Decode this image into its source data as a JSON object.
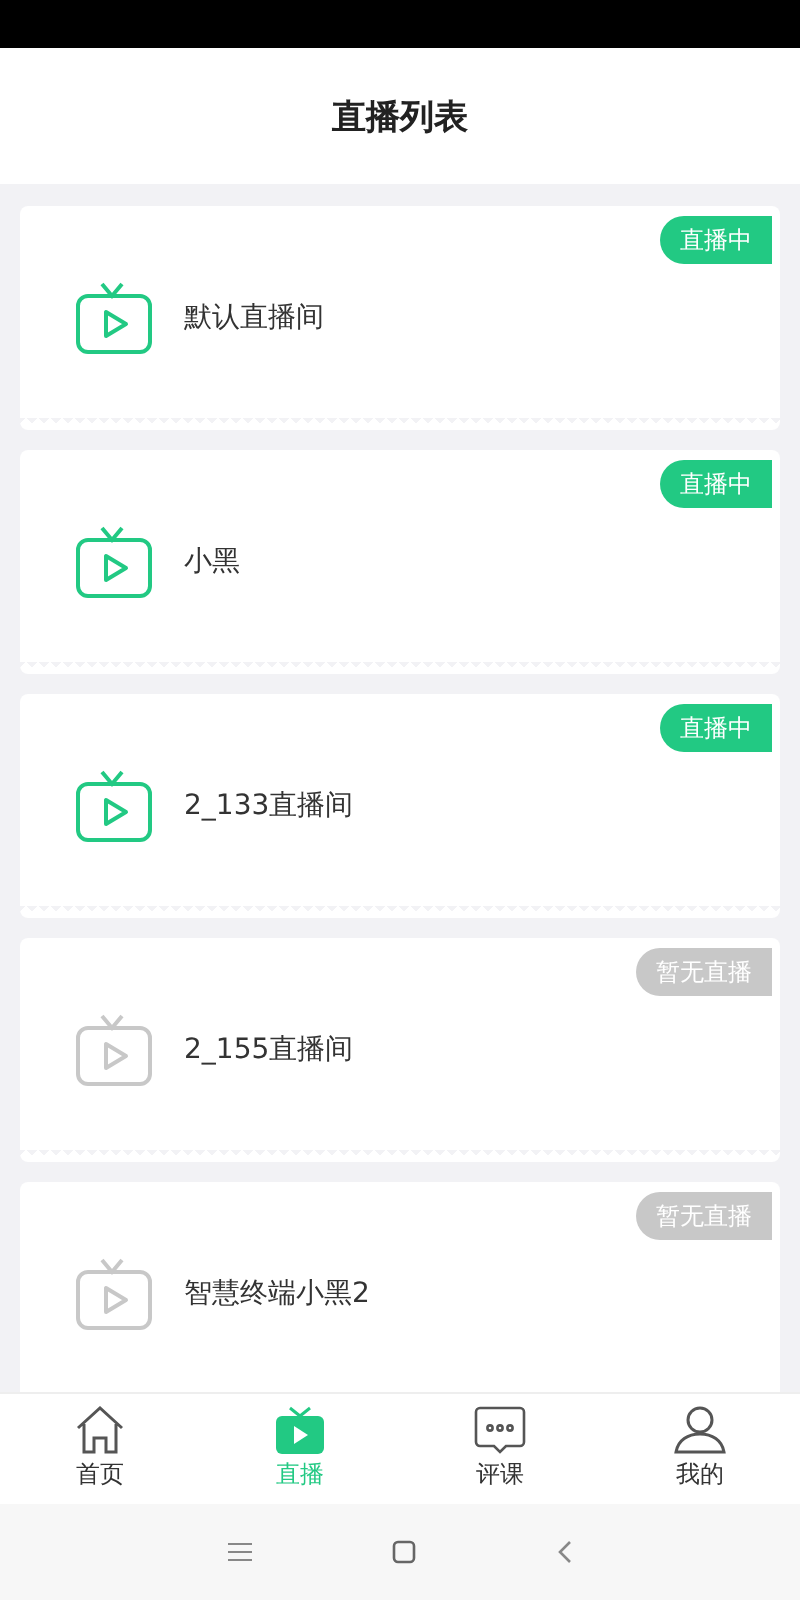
{
  "header": {
    "title": "直播列表"
  },
  "rooms": [
    {
      "name": "默认直播间",
      "live": true,
      "badge": "直播中"
    },
    {
      "name": "小黑",
      "live": true,
      "badge": "直播中"
    },
    {
      "name": "2_133直播间",
      "live": true,
      "badge": "直播中"
    },
    {
      "name": "2_155直播间",
      "live": false,
      "badge": "暂无直播"
    },
    {
      "name": "智慧终端小黑2",
      "live": false,
      "badge": "暂无直播"
    }
  ],
  "tabs": [
    {
      "kind": "home",
      "label": "首页",
      "selected": false
    },
    {
      "kind": "live",
      "label": "直播",
      "selected": true
    },
    {
      "kind": "review",
      "label": "评课",
      "selected": false
    },
    {
      "kind": "profile",
      "label": "我的",
      "selected": false
    }
  ]
}
